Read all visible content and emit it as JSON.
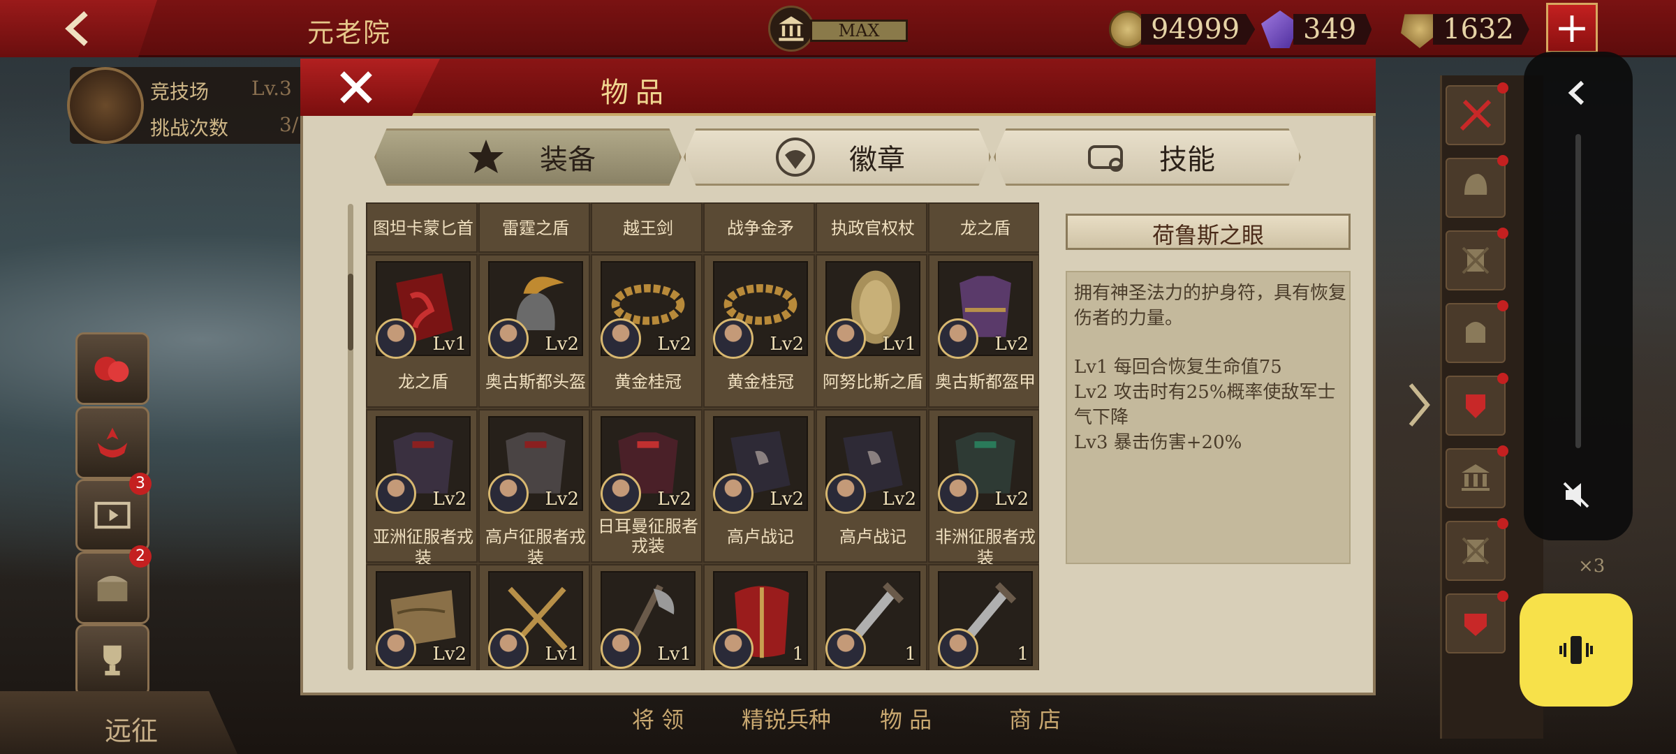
{
  "topbar": {
    "title": "元老院",
    "level_badge": "MAX",
    "gold": "94999",
    "gems": "349",
    "honor": "1632",
    "add_label": "+"
  },
  "arena": {
    "title": "竞技场",
    "level": "Lv.3",
    "challenge_label": "挑战次数",
    "challenge_value": "3/"
  },
  "left_buttons": [
    {
      "icon": "boxing-gloves-icon"
    },
    {
      "icon": "laurel-crest-icon"
    },
    {
      "icon": "film-icon",
      "badge": "3"
    },
    {
      "icon": "treasure-chest-icon",
      "badge": "2"
    },
    {
      "icon": "trophy-icon"
    }
  ],
  "expedition": "远征",
  "bottom_nav": [
    "将 领",
    "精锐兵种",
    "物 品",
    "商 店"
  ],
  "modal": {
    "title": "物品",
    "tabs": [
      {
        "label": "装备",
        "icon": "crossed-swords-star-icon",
        "active": true
      },
      {
        "label": "徽章",
        "icon": "eagle-emblem-icon",
        "active": false
      },
      {
        "label": "技能",
        "icon": "scroll-icon",
        "active": false
      }
    ],
    "top_row_names": [
      "图坦卡蒙匕首",
      "雷霆之盾",
      "越王剑",
      "战争金矛",
      "执政官权杖",
      "龙之盾"
    ],
    "rows": [
      [
        {
          "name": "龙之盾",
          "level": "Lv1",
          "icon": "red-dragon-shield-icon"
        },
        {
          "name": "奥古斯都头盔",
          "level": "Lv2",
          "icon": "plumed-helmet-icon"
        },
        {
          "name": "黄金桂冠",
          "level": "Lv2",
          "icon": "laurel-wreath-icon"
        },
        {
          "name": "黄金桂冠",
          "level": "Lv2",
          "icon": "laurel-wreath-icon"
        },
        {
          "name": "阿努比斯之盾",
          "level": "Lv1",
          "icon": "golden-shield-icon"
        },
        {
          "name": "奥古斯都盔甲",
          "level": "Lv2",
          "icon": "purple-armor-icon"
        }
      ],
      [
        {
          "name": "亚洲征服者戎装",
          "level": "Lv2",
          "icon": "dark-armor-icon"
        },
        {
          "name": "高卢征服者戎装",
          "level": "Lv2",
          "icon": "dark-armor-icon"
        },
        {
          "name": "日耳曼征服者戎装",
          "level": "Lv2",
          "icon": "red-armor-icon"
        },
        {
          "name": "高卢战记",
          "level": "Lv2",
          "icon": "book-icon"
        },
        {
          "name": "高卢战记",
          "level": "Lv2",
          "icon": "book-icon"
        },
        {
          "name": "非洲征服者戎装",
          "level": "Lv2",
          "icon": "green-armor-icon"
        }
      ],
      [
        {
          "level": "Lv2",
          "icon": "map-scroll-icon"
        },
        {
          "level": "Lv1",
          "icon": "crook-flail-icon"
        },
        {
          "level": "Lv1",
          "icon": "war-axe-icon"
        },
        {
          "level": "1",
          "icon": "red-shield-icon"
        },
        {
          "level": "1",
          "icon": "gladius-icon"
        },
        {
          "level": "1",
          "icon": "gladius-icon"
        }
      ]
    ],
    "detail": {
      "title": "荷鲁斯之眼",
      "description": "拥有神圣法力的护身符，具有恢复伤者的力量。",
      "effects": [
        "Lv1  每回合恢复生命值75",
        "Lv2  攻击时有25%概率使敌军士气下降",
        "Lv3  暴击伤害+20%"
      ]
    }
  },
  "right_panel": {
    "count": "×3",
    "slots": [
      "sword-icon",
      "helmet-icon",
      "crossed-shield-icon",
      "gladiator-helmet-icon",
      "red-crest-icon",
      "temple-icon",
      "crossed-shield-icon",
      "red-mask-icon"
    ]
  },
  "colors": {
    "topbar": "#6e1010",
    "accent": "#e6c88a",
    "yellow_button": "#f7e14a"
  }
}
